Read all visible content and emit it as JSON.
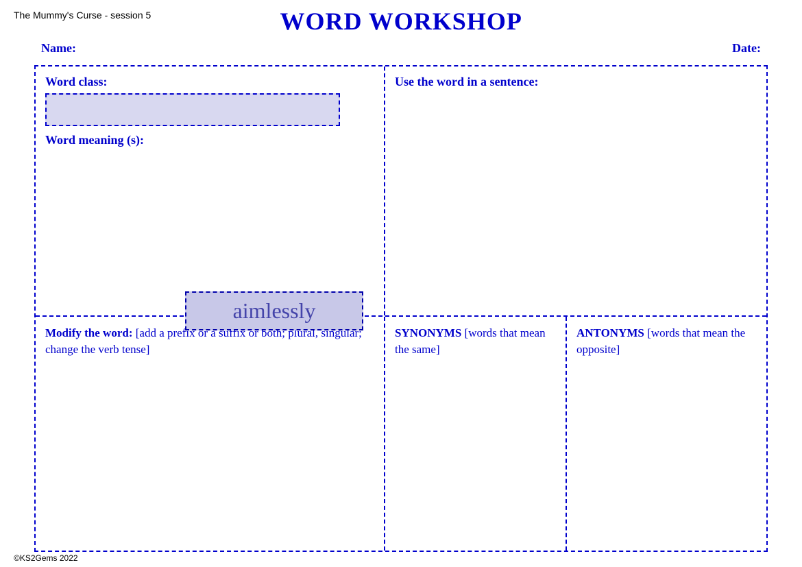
{
  "header": {
    "subtitle": "The Mummy's Curse - session 5",
    "title": "WORD WORKSHOP"
  },
  "nameLabel": "Name:",
  "dateLabel": "Date:",
  "wordClass": {
    "label": "Word class:"
  },
  "wordMeaning": {
    "label": "Word meaning (s):"
  },
  "useSentence": {
    "label": "Use the word in a sentence:"
  },
  "wordBadge": "aimlessly",
  "modifyWord": {
    "boldLabel": "Modify the word:",
    "description": " [add a prefix or a suffix or both; plural, singular; change the verb tense]"
  },
  "synonyms": {
    "boldLabel": "SYNONYMS",
    "description": " [words that mean the same]"
  },
  "antonyms": {
    "boldLabel": "ANTONYMS",
    "description": " [words that mean the opposite]"
  },
  "footer": "©KS2Gems 2022"
}
